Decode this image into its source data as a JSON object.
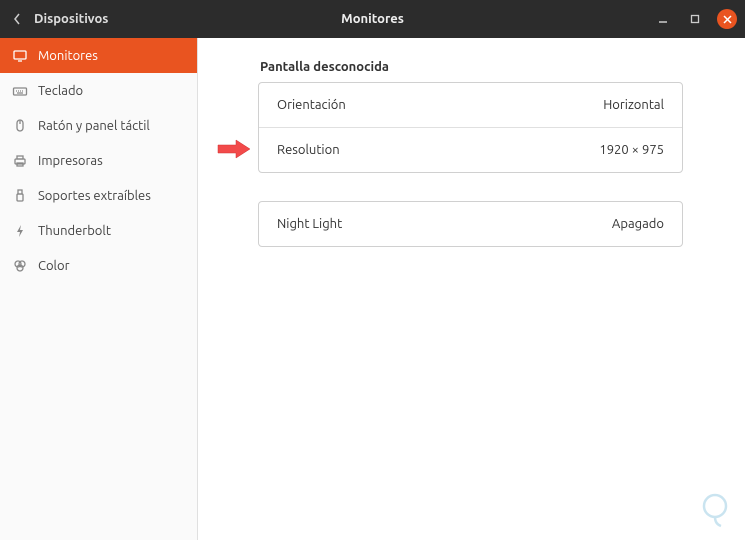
{
  "titlebar": {
    "back": "‹",
    "left_title": "Dispositivos",
    "center_title": "Monitores"
  },
  "sidebar": {
    "items": [
      {
        "label": "Monitores",
        "icon": "monitor-icon",
        "active": true
      },
      {
        "label": "Teclado",
        "icon": "keyboard-icon",
        "active": false
      },
      {
        "label": "Ratón y panel táctil",
        "icon": "mouse-icon",
        "active": false
      },
      {
        "label": "Impresoras",
        "icon": "printer-icon",
        "active": false
      },
      {
        "label": "Soportes extraíbles",
        "icon": "usb-icon",
        "active": false
      },
      {
        "label": "Thunderbolt",
        "icon": "thunderbolt-icon",
        "active": false
      },
      {
        "label": "Color",
        "icon": "color-icon",
        "active": false
      }
    ]
  },
  "content": {
    "section_title": "Pantalla desconocida",
    "panel1": {
      "orientation_label": "Orientación",
      "orientation_value": "Horizontal",
      "resolution_label": "Resolution",
      "resolution_value": "1920 × 975"
    },
    "panel2": {
      "nightlight_label": "Night Light",
      "nightlight_value": "Apagado"
    }
  },
  "colors": {
    "accent": "#e95420",
    "arrow": "#f24a4a"
  }
}
